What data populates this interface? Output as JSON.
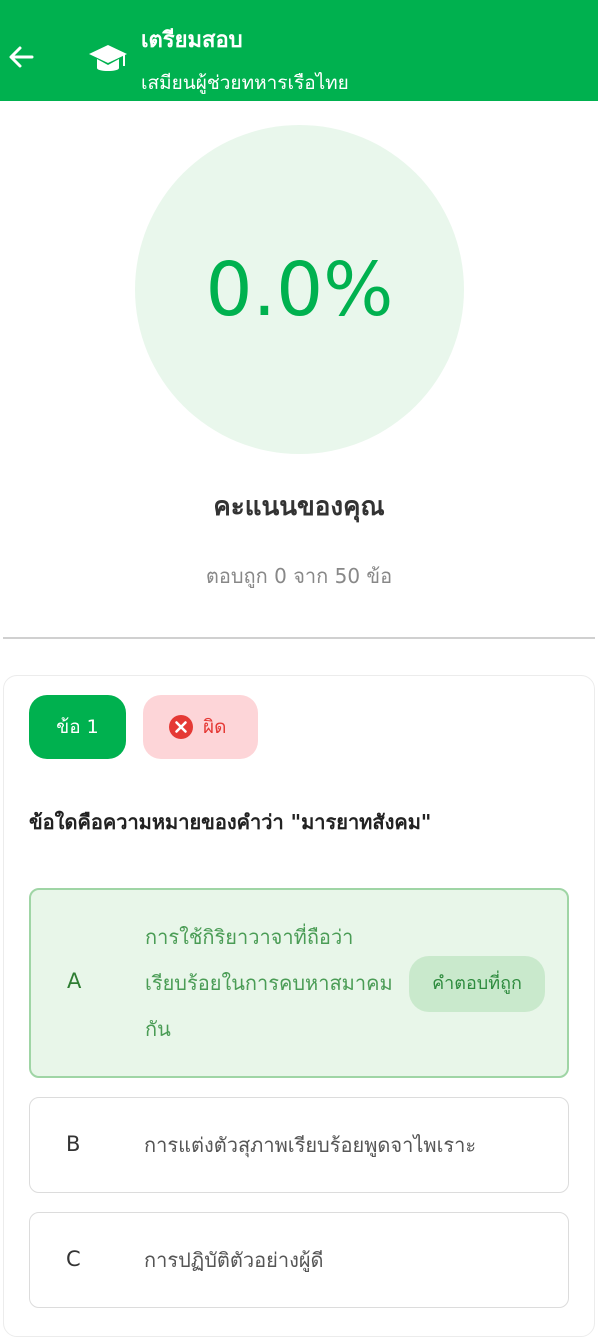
{
  "header": {
    "title": "เตรียมสอบ",
    "subtitle": "เสมียนผู้ช่วยทหารเรือไทย",
    "back_icon": "arrow-left-icon",
    "app_icon": "graduation-cap-icon"
  },
  "score": {
    "percent": "0.0%",
    "label": "คะแนนของคุณ",
    "detail": "ตอบถูก 0 จาก 50 ข้อ"
  },
  "question": {
    "number_label": "ข้อ 1",
    "status_label": "ผิด",
    "status_icon": "x-circle-icon",
    "text": "ข้อใดคือความหมายของคำว่า \"มารยาทสังคม\"",
    "options": [
      {
        "letter": "A",
        "lines": [
          "การใช้กิริยาวาจาที่ถือว่า",
          "เรียบร้อยในการคบหาสมาคม",
          "กัน"
        ],
        "correct_tag": "คำตอบที่ถูก"
      },
      {
        "letter": "B",
        "lines": [
          "การแต่งตัวสุภาพเรียบร้อยพูดจาไพเราะ"
        ]
      },
      {
        "letter": "C",
        "lines": [
          "การปฏิบัติตัวอย่างผู้ดี"
        ]
      }
    ]
  },
  "colors": {
    "primary": "#00b14f",
    "score_bg": "#e9f7ec",
    "wrong_bg": "#fdd5d8",
    "wrong_text": "#e53935",
    "correct_bg": "#e8f6e9"
  }
}
